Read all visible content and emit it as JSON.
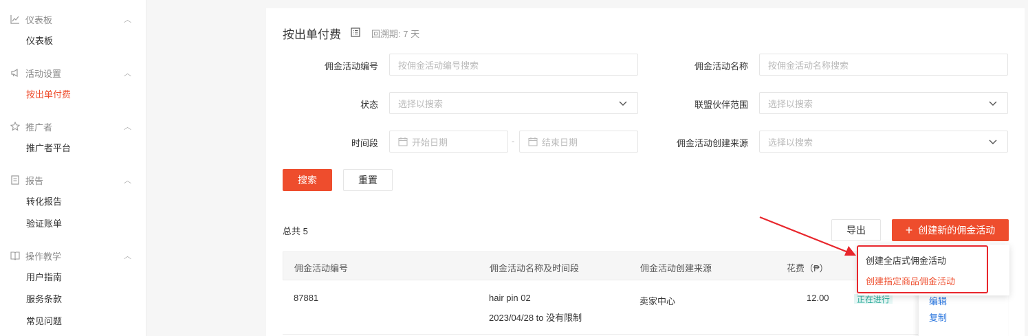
{
  "sidebar": {
    "groups": [
      {
        "title": "仪表板",
        "icon": "chart-line-icon",
        "items": [
          "仪表板"
        ]
      },
      {
        "title": "活动设置",
        "icon": "megaphone-icon",
        "items": [
          "按出单付费"
        ]
      },
      {
        "title": "推广者",
        "icon": "star-icon",
        "items": [
          "推广者平台"
        ]
      },
      {
        "title": "报告",
        "icon": "report-icon",
        "items": [
          "转化报告",
          "验证账单"
        ]
      },
      {
        "title": "操作教学",
        "icon": "book-icon",
        "items": [
          "用户指南",
          "服务条款",
          "常见问题"
        ]
      }
    ],
    "active_item": "按出单付费"
  },
  "header": {
    "title": "按出单付费",
    "subtitle": "回溯期: 7 天"
  },
  "filters": {
    "campaign_id": {
      "label": "佣金活动编号",
      "placeholder": "按佣金活动编号搜索"
    },
    "campaign_name": {
      "label": "佣金活动名称",
      "placeholder": "按佣金活动名称搜索"
    },
    "status": {
      "label": "状态",
      "placeholder": "选择以搜索"
    },
    "partner_scope": {
      "label": "联盟伙伴范围",
      "placeholder": "选择以搜索"
    },
    "period": {
      "label": "时间段",
      "start_placeholder": "开始日期",
      "end_placeholder": "结束日期",
      "separator": "-"
    },
    "source": {
      "label": "佣金活动创建来源",
      "placeholder": "选择以搜索"
    }
  },
  "buttons": {
    "search": "搜索",
    "reset": "重置",
    "export": "导出",
    "create": "创建新的佣金活动",
    "create_icon": "plus-icon"
  },
  "total_text": "总共 5",
  "table": {
    "columns": [
      "佣金活动编号",
      "佣金活动名称及时间段",
      "佣金活动创建来源",
      "花费（₱）"
    ],
    "rows": [
      {
        "id": "87881",
        "name": "hair pin 02",
        "period": "2023/04/28 to 没有限制",
        "source": "卖家中心",
        "cost": "12.00",
        "status": "正在进行",
        "actions": [
          "编辑",
          "复制"
        ]
      }
    ]
  },
  "dropdown": {
    "items": [
      "创建全店式佣金活动",
      "创建指定商品佣金活动"
    ]
  },
  "colors": {
    "accent": "#ee4d2d",
    "annotation": "#e8262c",
    "link": "#2673dd"
  }
}
